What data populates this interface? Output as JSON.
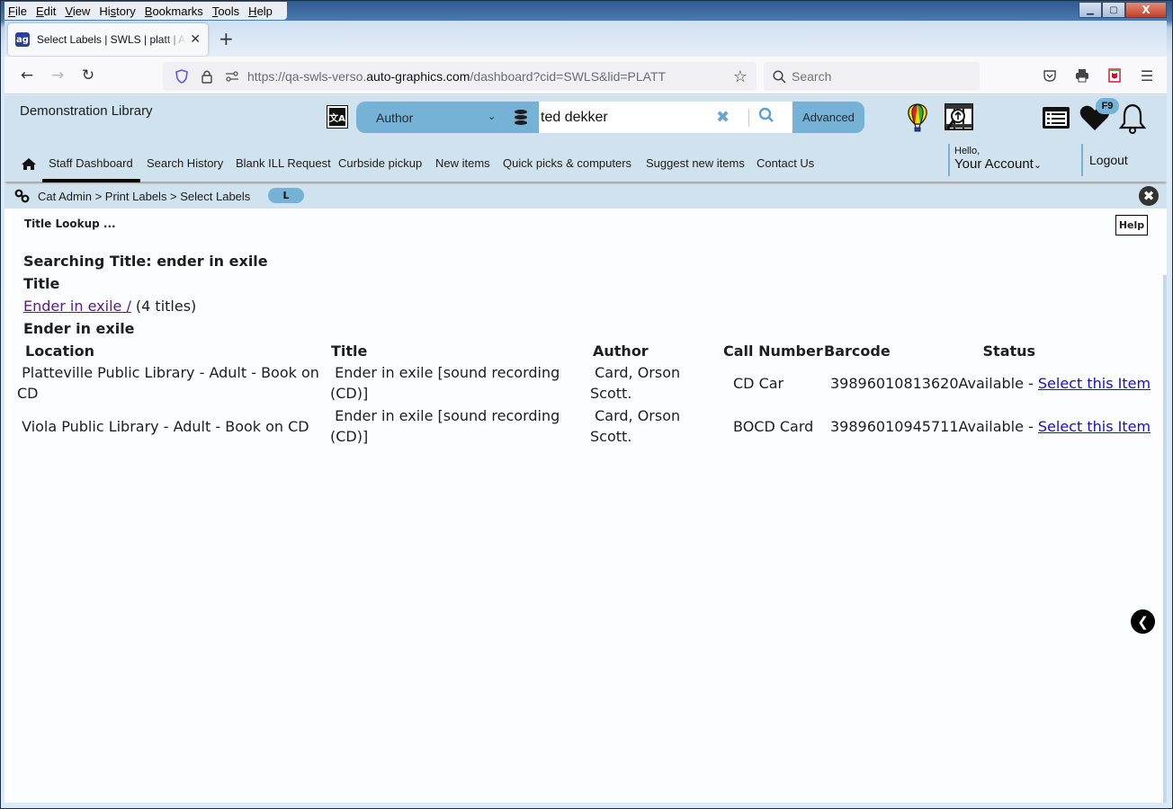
{
  "os": {
    "menu": [
      "File",
      "Edit",
      "View",
      "History",
      "Bookmarks",
      "Tools",
      "Help"
    ],
    "window_controls": [
      "minimize",
      "maximize",
      "close"
    ]
  },
  "browser": {
    "tab_title": "Select Labels | SWLS | platt | Auto-Graphics",
    "url_prefix": "https://qa-swls-verso.",
    "url_domain": "auto-graphics.com",
    "url_path": "/dashboard?cid=SWLS&lid=PLATT",
    "search_placeholder": "Search"
  },
  "header": {
    "library_name": "Demonstration Library",
    "search_type": "Author",
    "search_value": "ted dekker",
    "advanced_label": "Advanced",
    "favorites_badge": "F9"
  },
  "nav": {
    "items": [
      "Staff Dashboard",
      "Search History",
      "Blank ILL Request",
      "Curbside pickup",
      "New items",
      "Quick picks & computers",
      "Suggest new items",
      "Contact Us"
    ],
    "active": "Staff Dashboard",
    "hello": "Hello,",
    "account": "Your Account",
    "logout": "Logout"
  },
  "breadcrumb": {
    "text": "Cat Admin > Print Labels > Select Labels",
    "pill": "L"
  },
  "content": {
    "lookup_title": "Title Lookup ...",
    "help_label": "Help",
    "searching": "Searching Title: ender in exile",
    "title_heading": "Title",
    "title_link": "Ender in exile /",
    "title_count": "(4 titles)",
    "sub_heading": "Ender in exile",
    "table": {
      "headers": [
        "Location",
        "Title",
        "Author",
        "Call Number",
        "Barcode",
        "Status"
      ],
      "rows": [
        {
          "location": "Platteville Public Library - Adult - Book on CD",
          "title": "Ender in exile [sound recording (CD)]",
          "author": "Card, Orson Scott.",
          "call_number": "CD Car",
          "barcode": "39896010813620",
          "status": "Available - ",
          "action": "Select this Item"
        },
        {
          "location": "Viola Public Library - Adult - Book on CD",
          "title": "Ender in exile [sound recording (CD)]",
          "author": "Card, Orson Scott.",
          "call_number": "BOCD Card",
          "barcode": "39896010945711",
          "status": "Available - ",
          "action": "Select this Item"
        }
      ]
    }
  },
  "colors": {
    "header_bg": "#cfe2ee",
    "accent": "#76b2d5",
    "link_visited": "#5b1a86",
    "link": "#1a0dcc"
  }
}
